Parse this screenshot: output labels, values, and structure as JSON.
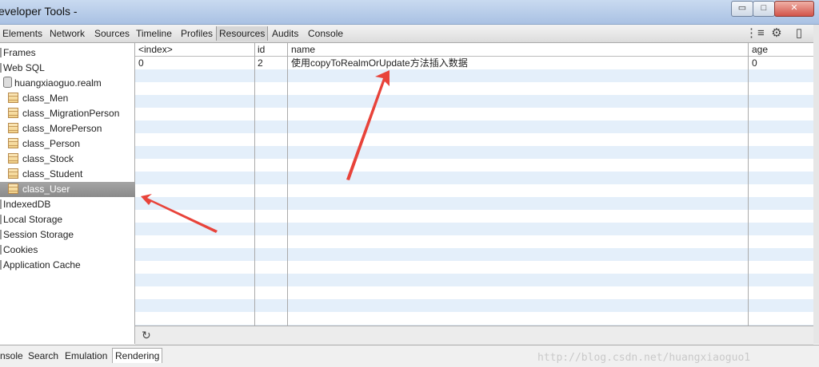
{
  "window": {
    "title": "eveloper Tools -",
    "buttons": {
      "minimize": "▭",
      "maximize": "□",
      "close": "✕"
    }
  },
  "toolbar": {
    "tabs": [
      "Elements",
      "Network",
      "Sources",
      "Timeline",
      "Profiles",
      "Resources",
      "Audits",
      "Console"
    ],
    "active_tab": "Resources",
    "icons": [
      "console-drawer-icon",
      "gear-icon",
      "dock-icon"
    ]
  },
  "sidebar": {
    "items": [
      {
        "label": "Frames"
      },
      {
        "label": "Web SQL"
      },
      {
        "label": "huangxiaoguo.realm"
      },
      {
        "label": "class_Men"
      },
      {
        "label": "class_MigrationPerson"
      },
      {
        "label": "class_MorePerson"
      },
      {
        "label": "class_Person"
      },
      {
        "label": "class_Stock"
      },
      {
        "label": "class_Student"
      },
      {
        "label": "class_User",
        "selected": true
      },
      {
        "label": "IndexedDB"
      },
      {
        "label": "Local Storage"
      },
      {
        "label": "Session Storage"
      },
      {
        "label": "Cookies"
      },
      {
        "label": "Application Cache"
      }
    ]
  },
  "table": {
    "columns": [
      "<index>",
      "id",
      "name",
      "age"
    ],
    "rows": [
      [
        "0",
        "2",
        "使用copyToRealmOrUpdate方法插入数据",
        "0"
      ]
    ]
  },
  "footer": {
    "refresh_icon": "refresh-icon",
    "refresh_glyph": "↻"
  },
  "drawer": {
    "tabs": [
      "nsole",
      "Search",
      "Emulation",
      "Rendering"
    ],
    "active_tab": "Rendering",
    "watermark": "http://blog.csdn.net/huangxiaoguo1"
  },
  "colors": {
    "annotation_arrow": "#e8433a",
    "row_stripe": "#e4effa",
    "selected_row": "#8a8a8a"
  }
}
